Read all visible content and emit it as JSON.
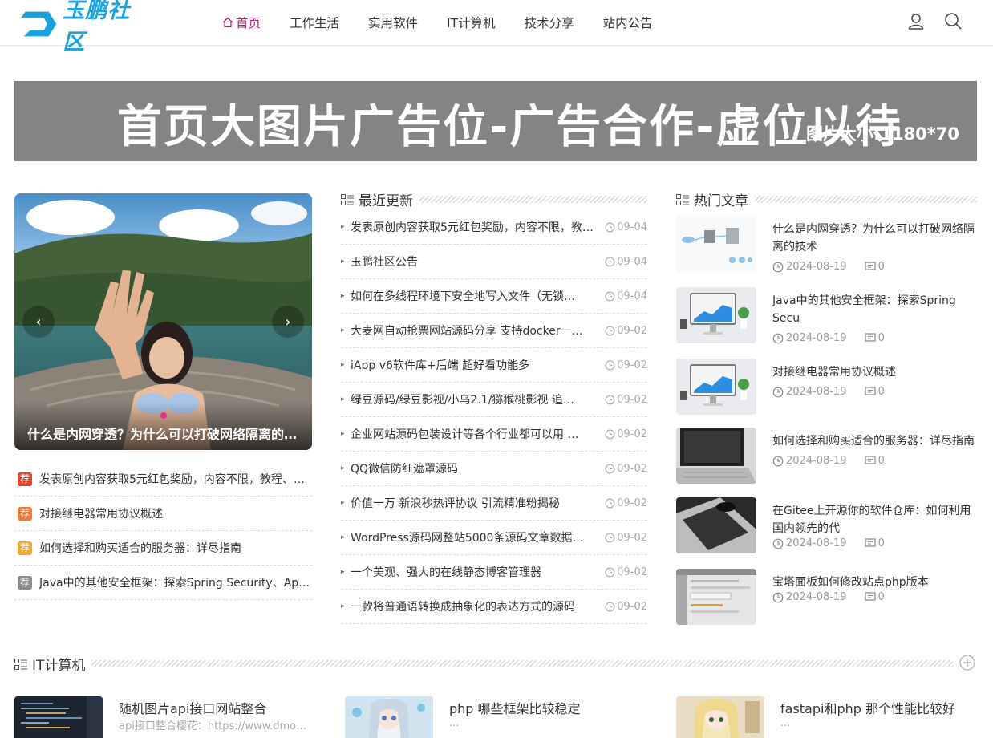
{
  "header": {
    "logo_text": "玉鹏社区",
    "nav": [
      {
        "label": "首页",
        "active": true
      },
      {
        "label": "工作生活"
      },
      {
        "label": "实用软件"
      },
      {
        "label": "IT计算机"
      },
      {
        "label": "技术分享"
      },
      {
        "label": "站内公告"
      }
    ],
    "icons": [
      "user-icon",
      "search-icon"
    ],
    "accent_color": "#c2187a"
  },
  "banner": {
    "main_text": "首页大图片广告位-广告合作-虚位以待",
    "sub_text": "图片大小:1180*70"
  },
  "slider": {
    "caption": "什么是内网穿透？为什么可以打破网络隔离的…",
    "prev": "‹",
    "next": "›"
  },
  "recommended": {
    "tag": "荐",
    "tag_colors": [
      "#e0452b",
      "#f07a3a",
      "#f0a830",
      "#8a8a8a"
    ],
    "items": [
      "发表原创内容获取5元红包奖励，内容不限，教程、…",
      "对接继电器常用协议概述",
      "如何选择和购买适合的服务器：详尽指南",
      "Java中的其他安全框架：探索Spring Security、Ap…"
    ]
  },
  "latest": {
    "title": "最近更新",
    "items": [
      {
        "title": "发表原创内容获取5元红包奖励，内容不限，教程、…",
        "date": "09-04"
      },
      {
        "title": "玉鹏社区公告",
        "date": "09-04"
      },
      {
        "title": "如何在多线程环境下安全地写入文件（无锁…",
        "date": "09-04"
      },
      {
        "title": "大麦网自动抢票网站源码分享 支持docker一…",
        "date": "09-02"
      },
      {
        "title": "iApp v6软件库+后端 超好看功能多",
        "date": "09-02"
      },
      {
        "title": "绿豆源码/绿豆影视/小乌2.1/猕猴桃影视 追…",
        "date": "09-02"
      },
      {
        "title": "企业网站源码包装设计等各个行业都可以用 …",
        "date": "09-02"
      },
      {
        "title": "QQ微信防红遮罩源码",
        "date": "09-02"
      },
      {
        "title": "价值一万 新浪秒热评协议 引流精准粉揭秘",
        "date": "09-02"
      },
      {
        "title": "WordPress源码网整站5000条源码文章数据…",
        "date": "09-02"
      },
      {
        "title": "一个美观、强大的在线静态博客管理器",
        "date": "09-02"
      },
      {
        "title": "一款将普通语转换成抽象化的表达方式的源码",
        "date": "09-02"
      }
    ]
  },
  "hot": {
    "title": "热门文章",
    "items": [
      {
        "title": "什么是内网穿透？为什么可以打破网络隔离的技术",
        "date": "2024-08-19",
        "comments": "0"
      },
      {
        "title": "Java中的其他安全框架：探索Spring Secu",
        "date": "2024-08-19",
        "comments": "0"
      },
      {
        "title": "对接继电器常用协议概述",
        "date": "2024-08-19",
        "comments": "0"
      },
      {
        "title": "如何选择和购买适合的服务器：详尽指南",
        "date": "2024-08-19",
        "comments": "0"
      },
      {
        "title": "在Gitee上开源你的软件仓库：如何利用国内领先的代",
        "date": "2024-08-19",
        "comments": "0"
      },
      {
        "title": "宝塔面板如何修改站点php版本",
        "date": "2024-08-19",
        "comments": "0"
      }
    ]
  },
  "it_section": {
    "title": "IT计算机",
    "items": [
      {
        "title": "随机图片api接口网站整合",
        "desc": "api接口整合樱花：https://www.dmoe…"
      },
      {
        "title": "php 哪些框架比较稳定",
        "desc": "..."
      },
      {
        "title": "fastapi和php 那个性能比较好",
        "desc": "..."
      }
    ]
  }
}
